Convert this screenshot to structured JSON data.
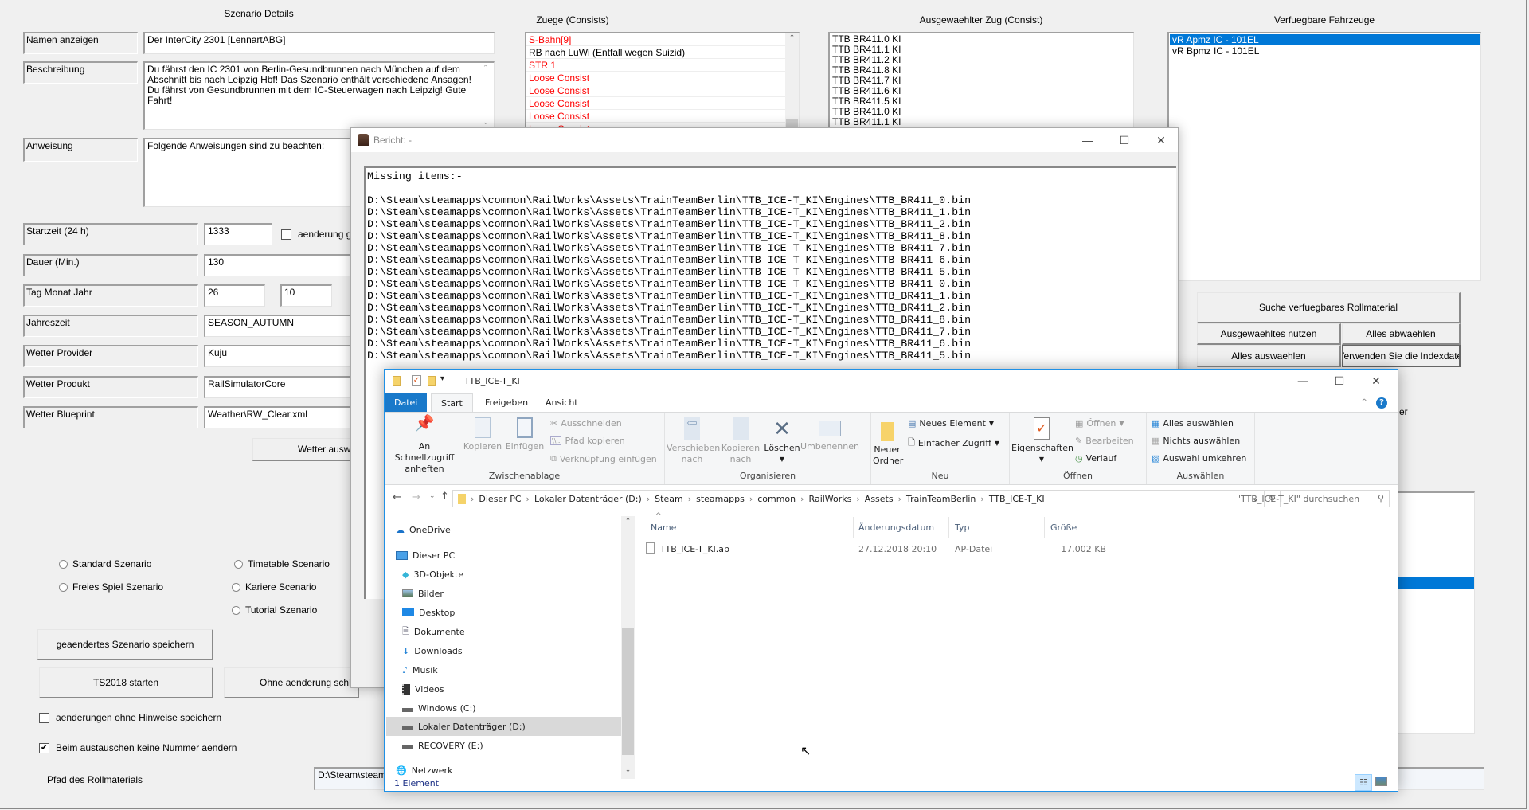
{
  "app": {
    "title": "Szenario Details",
    "fields": {
      "name_label": "Namen anzeigen",
      "name_value": "Der InterCity 2301    [LennartABG]",
      "desc_label": "Beschreibung",
      "desc_value": "Du fährst den IC 2301 von Berlin-Gesundbrunnen nach München auf dem Abschnitt bis nach Leipzig Hbf! Das Szenario enthält verschiedene Ansagen! Du fährst von Gesundbrunnen mit dem IC-Steuerwagen nach Leipzig!    Gute Fahrt!",
      "instr_label": "Anweisung",
      "instr_value": "Folgende Anweisungen sind zu beachten:",
      "start_label": "Startzeit (24 h)",
      "start_value": "1333",
      "change_applies_label": "aenderung gilt",
      "duration_label": "Dauer (Min.)",
      "duration_value": "130",
      "date_label": "Tag Monat Jahr",
      "day_value": "26",
      "month_value": "10",
      "season_label": "Jahreszeit",
      "season_value": "SEASON_AUTUMN",
      "weather_provider_label": "Wetter Provider",
      "weather_provider_value": "Kuju",
      "weather_product_label": "Wetter Produkt",
      "weather_product_value": "RailSimulatorCore",
      "weather_blueprint_label": "Wetter Blueprint",
      "weather_blueprint_value": "Weather\\RW_Clear.xml",
      "weather_select_button": "Wetter auswa"
    },
    "scenario_types": {
      "standard": "Standard Szenario",
      "timetable": "Timetable Scenario",
      "free": "Freies Spiel Szenario",
      "career": "Kariere Scenario",
      "tutorial": "Tutorial Szenario"
    },
    "buttons": {
      "save": "geaendertes Szenario speichern",
      "start_ts": "TS2018 starten",
      "close_no_change": "Ohne aenderung schlies",
      "search_rolling": "Suche verfuegbares Rollmaterial",
      "use_selected": "Ausgewaehltes nutzen",
      "deselect_all": "Alles abwaehlen",
      "select_all": "Alles auswaehlen",
      "use_index": "Verwenden Sie die Indexdatei"
    },
    "checkboxes": {
      "save_no_hints": "aenderungen ohne Hinweise speichern",
      "keep_numbers": "Beim austauschen keine Nummer aendern",
      "keep_numbers_checked": true,
      "save_no_hints_checked": false
    },
    "rolling_path_label": "Pfad des Rollmaterials",
    "rolling_path_value": "D:\\Steam\\steama",
    "partial_text_er": "er",
    "consists_label": "Zuege (Consists)",
    "consists": [
      {
        "label": "S-Bahn[9]",
        "color": "#ff0000"
      },
      {
        "label": "RB nach LuWi (Entfall wegen Suizid)",
        "color": "#000000"
      },
      {
        "label": "STR 1",
        "color": "#ff0000"
      },
      {
        "label": "Loose Consist",
        "color": "#ff0000"
      },
      {
        "label": "Loose Consist",
        "color": "#ff0000"
      },
      {
        "label": "Loose Consist",
        "color": "#ff0000"
      },
      {
        "label": "Loose Consist",
        "color": "#ff0000"
      },
      {
        "label": "Loose Consist",
        "color": "#ff0000"
      }
    ],
    "selected_train_label": "Ausgewaehlter Zug (Consist)",
    "selected_train": [
      "TTB BR411.0 KI",
      "TTB BR411.1 KI",
      "TTB BR411.2 KI",
      "TTB BR411.8 KI",
      "TTB BR411.7 KI",
      "TTB BR411.6 KI",
      "TTB BR411.5 KI",
      "TTB BR411.0 KI",
      "TTB BR411.1 KI"
    ],
    "vehicles_label": "Verfuegbare Fahrzeuge",
    "vehicles": [
      "vR Apmz IC - 101EL",
      "vR Bpmz IC - 101EL"
    ],
    "vehicles_selected_index": 0
  },
  "report": {
    "title": "Bericht: -",
    "lines": [
      "Missing items:-",
      "",
      "D:\\Steam\\steamapps\\common\\RailWorks\\Assets\\TrainTeamBerlin\\TTB_ICE-T_KI\\Engines\\TTB_BR411_0.bin",
      "D:\\Steam\\steamapps\\common\\RailWorks\\Assets\\TrainTeamBerlin\\TTB_ICE-T_KI\\Engines\\TTB_BR411_1.bin",
      "D:\\Steam\\steamapps\\common\\RailWorks\\Assets\\TrainTeamBerlin\\TTB_ICE-T_KI\\Engines\\TTB_BR411_2.bin",
      "D:\\Steam\\steamapps\\common\\RailWorks\\Assets\\TrainTeamBerlin\\TTB_ICE-T_KI\\Engines\\TTB_BR411_8.bin",
      "D:\\Steam\\steamapps\\common\\RailWorks\\Assets\\TrainTeamBerlin\\TTB_ICE-T_KI\\Engines\\TTB_BR411_7.bin",
      "D:\\Steam\\steamapps\\common\\RailWorks\\Assets\\TrainTeamBerlin\\TTB_ICE-T_KI\\Engines\\TTB_BR411_6.bin",
      "D:\\Steam\\steamapps\\common\\RailWorks\\Assets\\TrainTeamBerlin\\TTB_ICE-T_KI\\Engines\\TTB_BR411_5.bin",
      "D:\\Steam\\steamapps\\common\\RailWorks\\Assets\\TrainTeamBerlin\\TTB_ICE-T_KI\\Engines\\TTB_BR411_0.bin",
      "D:\\Steam\\steamapps\\common\\RailWorks\\Assets\\TrainTeamBerlin\\TTB_ICE-T_KI\\Engines\\TTB_BR411_1.bin",
      "D:\\Steam\\steamapps\\common\\RailWorks\\Assets\\TrainTeamBerlin\\TTB_ICE-T_KI\\Engines\\TTB_BR411_2.bin",
      "D:\\Steam\\steamapps\\common\\RailWorks\\Assets\\TrainTeamBerlin\\TTB_ICE-T_KI\\Engines\\TTB_BR411_8.bin",
      "D:\\Steam\\steamapps\\common\\RailWorks\\Assets\\TrainTeamBerlin\\TTB_ICE-T_KI\\Engines\\TTB_BR411_7.bin",
      "D:\\Steam\\steamapps\\common\\RailWorks\\Assets\\TrainTeamBerlin\\TTB_ICE-T_KI\\Engines\\TTB_BR411_6.bin",
      "D:\\Steam\\steamapps\\common\\RailWorks\\Assets\\TrainTeamBerlin\\TTB_ICE-T_KI\\Engines\\TTB_BR411_5.bin"
    ]
  },
  "explorer": {
    "title": "TTB_ICE-T_KI",
    "tabs": [
      "Datei",
      "Start",
      "Freigeben",
      "Ansicht"
    ],
    "ribbon": {
      "pin": "An Schnellzugriff anheften",
      "copy": "Kopieren",
      "paste": "Einfügen",
      "cut": "Ausschneiden",
      "copy_path": "Pfad kopieren",
      "paste_shortcut": "Verknüpfung einfügen",
      "group_clipboard": "Zwischenablage",
      "move_to": "Verschieben nach",
      "copy_to": "Kopieren nach",
      "delete": "Löschen",
      "rename": "Umbenennen",
      "group_organize": "Organisieren",
      "new_folder": "Neuer Ordner",
      "new_item": "Neues Element",
      "easy_access": "Einfacher Zugriff",
      "group_new": "Neu",
      "properties": "Eigenschaften",
      "open": "Öffnen",
      "edit": "Bearbeiten",
      "history": "Verlauf",
      "group_open": "Öffnen",
      "select_all": "Alles auswählen",
      "select_none": "Nichts auswählen",
      "invert": "Auswahl umkehren",
      "group_select": "Auswählen"
    },
    "breadcrumb": [
      "Dieser PC",
      "Lokaler Datenträger (D:)",
      "Steam",
      "steamapps",
      "common",
      "RailWorks",
      "Assets",
      "TrainTeamBerlin",
      "TTB_ICE-T_KI"
    ],
    "search_placeholder": "\"TTB_ICE-T_KI\" durchsuchen",
    "nav": {
      "onedrive": "OneDrive",
      "this_pc": "Dieser PC",
      "objects3d": "3D-Objekte",
      "pictures": "Bilder",
      "desktop": "Desktop",
      "documents": "Dokumente",
      "downloads": "Downloads",
      "music": "Musik",
      "videos": "Videos",
      "drive_c": "Windows (C:)",
      "drive_d": "Lokaler Datenträger (D:)",
      "drive_e": "RECOVERY (E:)",
      "network": "Netzwerk"
    },
    "columns": {
      "name": "Name",
      "date": "Änderungsdatum",
      "type": "Typ",
      "size": "Größe"
    },
    "files": [
      {
        "name": "TTB_ICE-T_KI.ap",
        "date": "27.12.2018 20:10",
        "type": "AP-Datei",
        "size": "17.002 KB"
      }
    ],
    "status": "1 Element"
  }
}
